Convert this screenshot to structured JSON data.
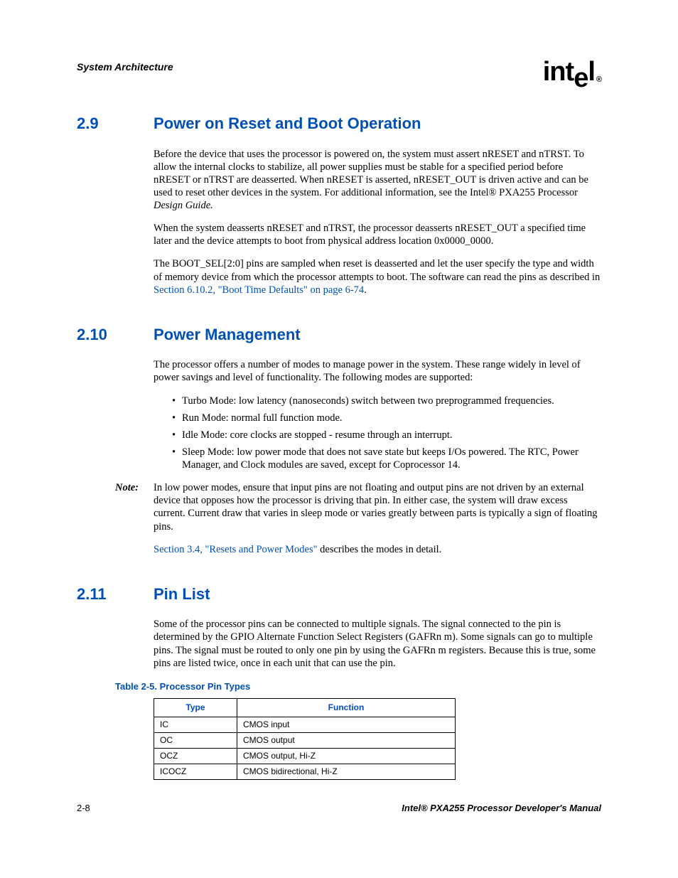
{
  "header": {
    "section": "System Architecture",
    "logo_main": "int",
    "logo_drop": "e",
    "logo_end": "l",
    "logo_reg": "®"
  },
  "s29": {
    "num": "2.9",
    "title": "Power on Reset and Boot Operation",
    "p1a": "Before the device that uses the processor is powered on, the system must assert nRESET and nTRST. To allow the internal clocks to stabilize, all power supplies must be stable for a specified period before nRESET or nTRST are deasserted. When nRESET is asserted, nRESET_OUT is driven active and can be used to reset other devices in the system. For additional information, see the Intel® PXA255 Processor ",
    "p1b": "Design Guide.",
    "p2": "When the system deasserts nRESET and nTRST, the processor deasserts nRESET_OUT a specified time later and the device attempts to boot from physical address location 0x0000_0000.",
    "p3a": "The BOOT_SEL[2:0] pins are sampled when reset is deasserted and let the user specify the type and width of memory device from which the processor attempts to boot. The software can read the pins as described in ",
    "p3link": "Section 6.10.2, \"Boot Time Defaults\" on page 6-74",
    "p3b": "."
  },
  "s210": {
    "num": "2.10",
    "title": "Power Management",
    "p1": "The processor offers a number of modes to manage power in the system. These range widely in level of power savings and level of functionality. The following modes are supported:",
    "bullets": [
      "Turbo Mode: low latency (nanoseconds) switch between two preprogrammed frequencies.",
      "Run Mode: normal full function mode.",
      "Idle Mode: core clocks are stopped - resume through an interrupt.",
      "Sleep Mode: low power mode that does not save state but keeps I/Os powered. The RTC, Power Manager, and Clock modules are saved, except for Coprocessor 14."
    ],
    "note_label": "Note:",
    "note_body": "In low power modes, ensure that input pins are not floating and output pins are not driven by an external device that opposes how the processor is driving that pin. In either case, the system will draw excess current. Current draw that varies in sleep mode or varies greatly between parts is typically a sign of floating pins.",
    "p2link": "Section 3.4, \"Resets and Power Modes\"",
    "p2b": " describes the modes in detail."
  },
  "s211": {
    "num": "2.11",
    "title": "Pin List",
    "p1": "Some of the processor pins can be connected to multiple signals. The signal connected to the pin is determined by the GPIO Alternate Function Select Registers (GAFRn m). Some signals can go to multiple pins. The signal must be routed to only one pin by using the GAFRn m registers. Because this is true, some pins are listed twice, once in each unit that can use the pin."
  },
  "table": {
    "caption": "Table 2-5. Processor Pin Types",
    "headers": [
      "Type",
      "Function"
    ],
    "rows": [
      [
        "IC",
        "CMOS input"
      ],
      [
        "OC",
        "CMOS output"
      ],
      [
        "OCZ",
        "CMOS output, Hi-Z"
      ],
      [
        "ICOCZ",
        "CMOS bidirectional, Hi-Z"
      ]
    ]
  },
  "footer": {
    "left": "2-8",
    "right": "Intel® PXA255 Processor Developer's Manual"
  }
}
